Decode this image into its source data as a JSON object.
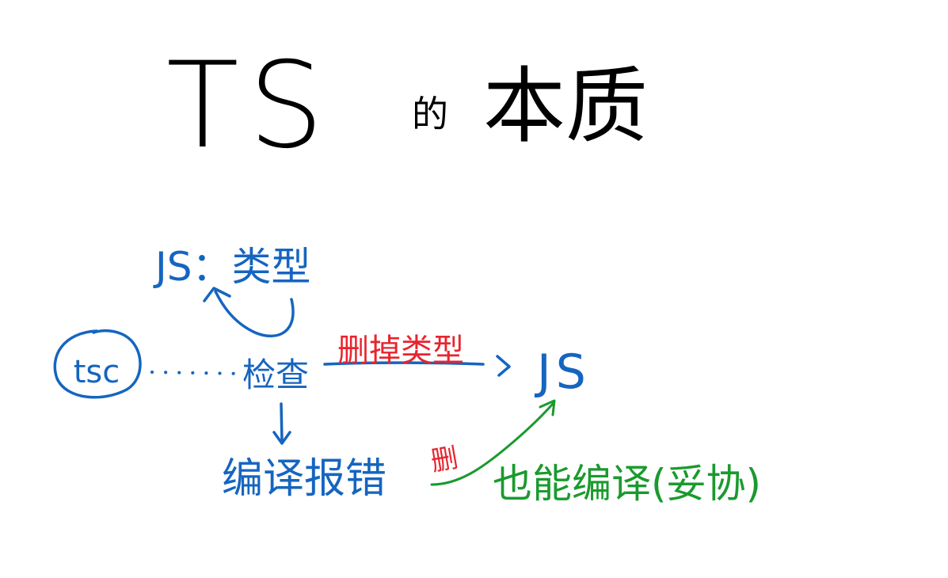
{
  "title": {
    "latin": "TS",
    "particle": "的",
    "main": "本质",
    "color": "#000000"
  },
  "nodes": {
    "tsc": "tsc",
    "check": "检查",
    "js_types": "JS：类型",
    "js_output": "JS",
    "compile_error": "编译报错",
    "can_compile": "也能编译(妥协)"
  },
  "edge_labels": {
    "remove_types": "删掉类型",
    "remove_short": "删"
  },
  "colors": {
    "blue": "#1565c0",
    "red": "#e8242e",
    "green": "#1a9a2e",
    "black": "#000000"
  }
}
